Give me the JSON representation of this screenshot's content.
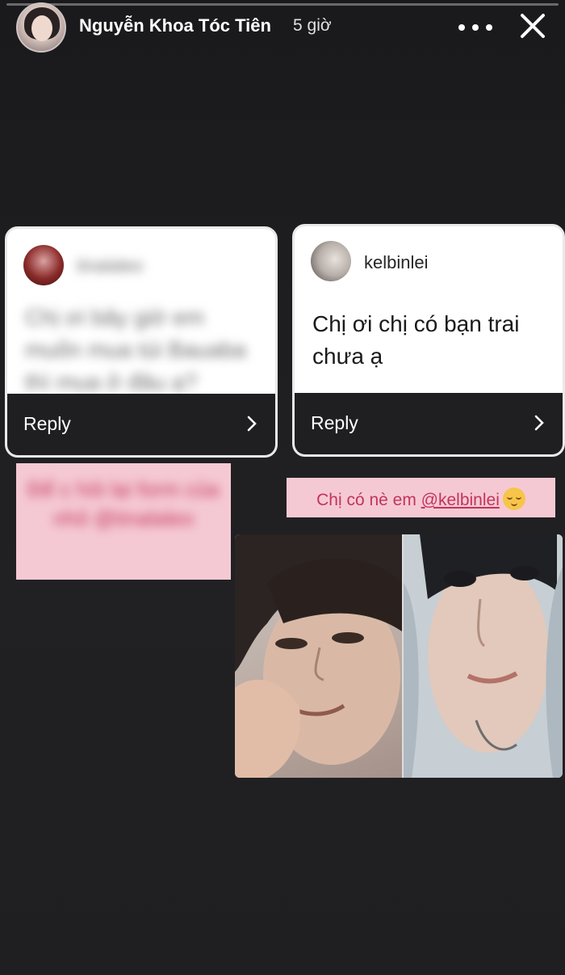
{
  "story": {
    "author_name": "Nguyễn Khoa Tóc Tiên",
    "time_ago": "5 giờ"
  },
  "header_icons": {
    "more": "more-dots-icon",
    "close": "close-icon"
  },
  "question_cards": [
    {
      "handle": "tinalaleo",
      "question": "Chị ơi bây giờ em muốn mua túi Bauaba thì mua ở đâu ạ?",
      "blurred": true,
      "reply_label": "Reply"
    },
    {
      "handle": "kelbinlei",
      "question": "Chị ơi chị có bạn trai chưa ạ",
      "blurred": false,
      "reply_label": "Reply"
    }
  ],
  "answers": [
    {
      "text": "Để c hỏi lại form của nhỏ @tinalaleo",
      "blurred": true
    },
    {
      "text": "Chị có nè em ",
      "mention": "@kelbinlei",
      "emoji": "relieved-face-emoji"
    }
  ],
  "colors": {
    "background": "#1c1c1e",
    "answer_sticker_bg": "#f5c9d3",
    "answer_sticker_text": "#c3345c"
  }
}
